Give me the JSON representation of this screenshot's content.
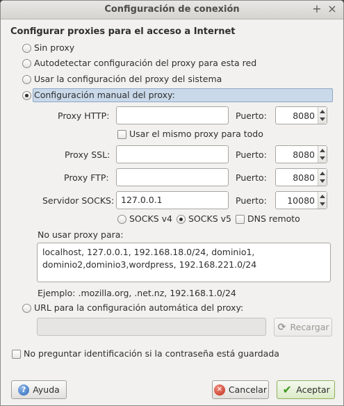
{
  "window": {
    "title": "Configuración de conexión",
    "title_buttons": [
      "+",
      "×"
    ]
  },
  "section_title": "Configurar proxies para el acceso a Internet",
  "options": {
    "no_proxy": "Sin proxy",
    "autodetect": "Autodetectar configuración del proxy para esta red",
    "system": "Usar la configuración del proxy del sistema",
    "manual": "Configuración manual del proxy:",
    "auto_url": "URL para la configuración automática del proxy:",
    "selected": "manual"
  },
  "manual": {
    "http_label": "Proxy HTTP:",
    "http_value": "",
    "http_port": "8080",
    "same_proxy": "Usar el mismo proxy para todo",
    "ssl_label": "Proxy SSL:",
    "ssl_value": "",
    "ssl_port": "8080",
    "ftp_label": "Proxy FTP:",
    "ftp_value": "",
    "ftp_port": "8080",
    "socks_label": "Servidor SOCKS:",
    "socks_value": "127.0.0.1",
    "socks_port": "10080",
    "port_label": "Puerto:",
    "socks_v4": "SOCKS v4",
    "socks_v5": "SOCKS v5",
    "socks_selected": "v5",
    "dns_remote": "DNS remoto"
  },
  "no_proxy": {
    "label": "No usar proxy para:",
    "value": "localhost, 127.0.0.1, 192.168.18.0/24, dominio1,\ndominio2,dominio3,wordpress, 192.168.221.0/24",
    "example": "Ejemplo: .mozilla.org, .net.nz, 192.168.1.0/24"
  },
  "auto_url": {
    "value": "",
    "reload_button": "Recargar"
  },
  "no_prompt": "No preguntar identificación si la contraseña está guardada",
  "buttons": {
    "help": "Ayuda",
    "cancel": "Cancelar",
    "ok": "Aceptar"
  },
  "icons": {
    "help": "help-icon",
    "cancel": "cancel-icon",
    "ok": "checkmark-icon",
    "reload": "reload-icon"
  }
}
